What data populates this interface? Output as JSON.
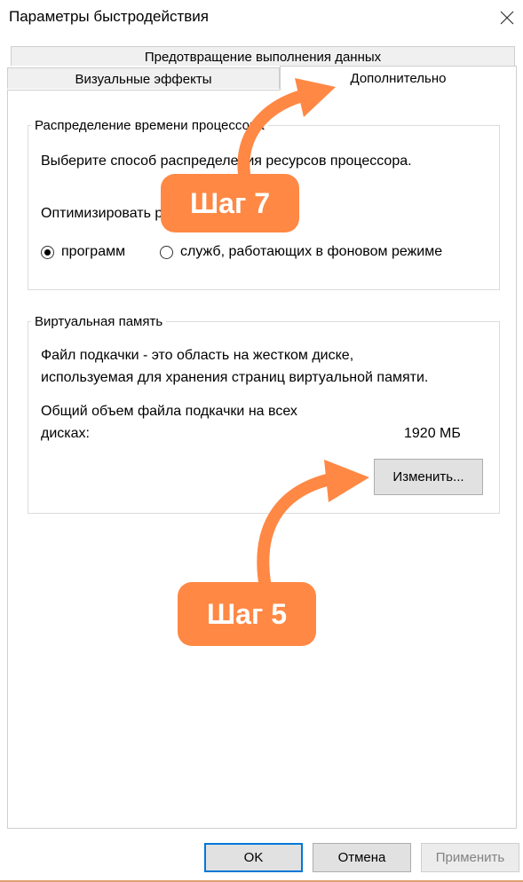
{
  "window": {
    "title": "Параметры быстродействия"
  },
  "tabs": {
    "dep": "Предотвращение выполнения данных",
    "visual": "Визуальные эффекты",
    "advanced": "Дополнительно"
  },
  "cpu_group": {
    "legend": "Распределение времени процессора",
    "description": "Выберите способ распределения ресурсов процессора.",
    "optimize_label": "Оптимизировать работу:",
    "options": [
      {
        "label": "программ",
        "selected": true
      },
      {
        "label": "служб, работающих в фоновом режиме",
        "selected": false
      }
    ]
  },
  "vm_group": {
    "legend": "Виртуальная память",
    "description_line1": "Файл подкачки - это область на жестком диске,",
    "description_line2": "используемая для хранения страниц виртуальной памяти.",
    "total_line1": "Общий объем файла подкачки на всех",
    "total_line2": "дисках:",
    "total_value": "1920 МБ",
    "change_button": "Изменить..."
  },
  "footer": {
    "ok": "OK",
    "cancel": "Отмена",
    "apply": "Применить"
  },
  "annotations": {
    "step7": "Шаг 7",
    "step5": "Шаг 5",
    "color": "#ff8844"
  }
}
